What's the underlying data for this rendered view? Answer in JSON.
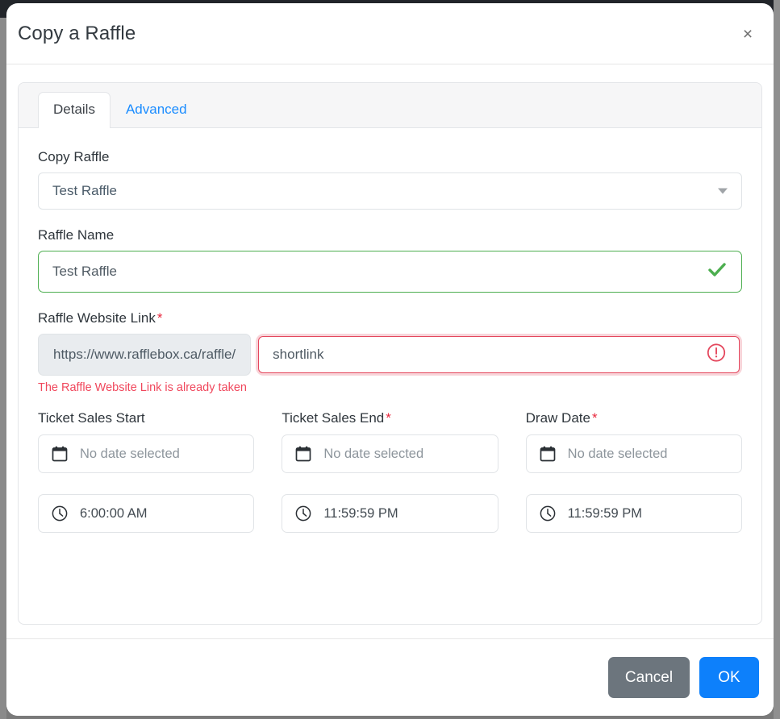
{
  "modal": {
    "title": "Copy a Raffle",
    "close_icon": "close-icon",
    "close_label": "×"
  },
  "tabs": [
    {
      "label": "Details",
      "active": true
    },
    {
      "label": "Advanced",
      "active": false
    }
  ],
  "form": {
    "copy_raffle": {
      "label": "Copy Raffle",
      "value": "Test Raffle",
      "icon": "chevron-down-icon"
    },
    "raffle_name": {
      "label": "Raffle Name",
      "value": "Test Raffle",
      "valid_icon": "check-icon",
      "valid_color": "#4cae4f"
    },
    "raffle_website_link": {
      "label": "Raffle Website Link",
      "required_marker": "*",
      "prefix": "https://www.rafflebox.ca/raffle/",
      "value": "shortlink",
      "error_icon": "exclamation-circle-icon",
      "error_message": "The Raffle Website Link is already taken",
      "error_color": "#f0475c"
    },
    "datetime": [
      {
        "label": "Ticket Sales Start",
        "required_marker": "",
        "date_icon": "calendar-icon",
        "date_value": "No date selected",
        "time_icon": "clock-icon",
        "time_value": "6:00:00 AM"
      },
      {
        "label": "Ticket Sales End",
        "required_marker": "*",
        "date_icon": "calendar-icon",
        "date_value": "No date selected",
        "time_icon": "clock-icon",
        "time_value": "11:59:59 PM"
      },
      {
        "label": "Draw Date",
        "required_marker": "*",
        "date_icon": "calendar-icon",
        "date_value": "No date selected",
        "time_icon": "clock-icon",
        "time_value": "11:59:59 PM"
      }
    ]
  },
  "footer": {
    "cancel_label": "Cancel",
    "ok_label": "OK",
    "cancel_color": "#6c757d",
    "ok_color": "#0d80fb"
  }
}
